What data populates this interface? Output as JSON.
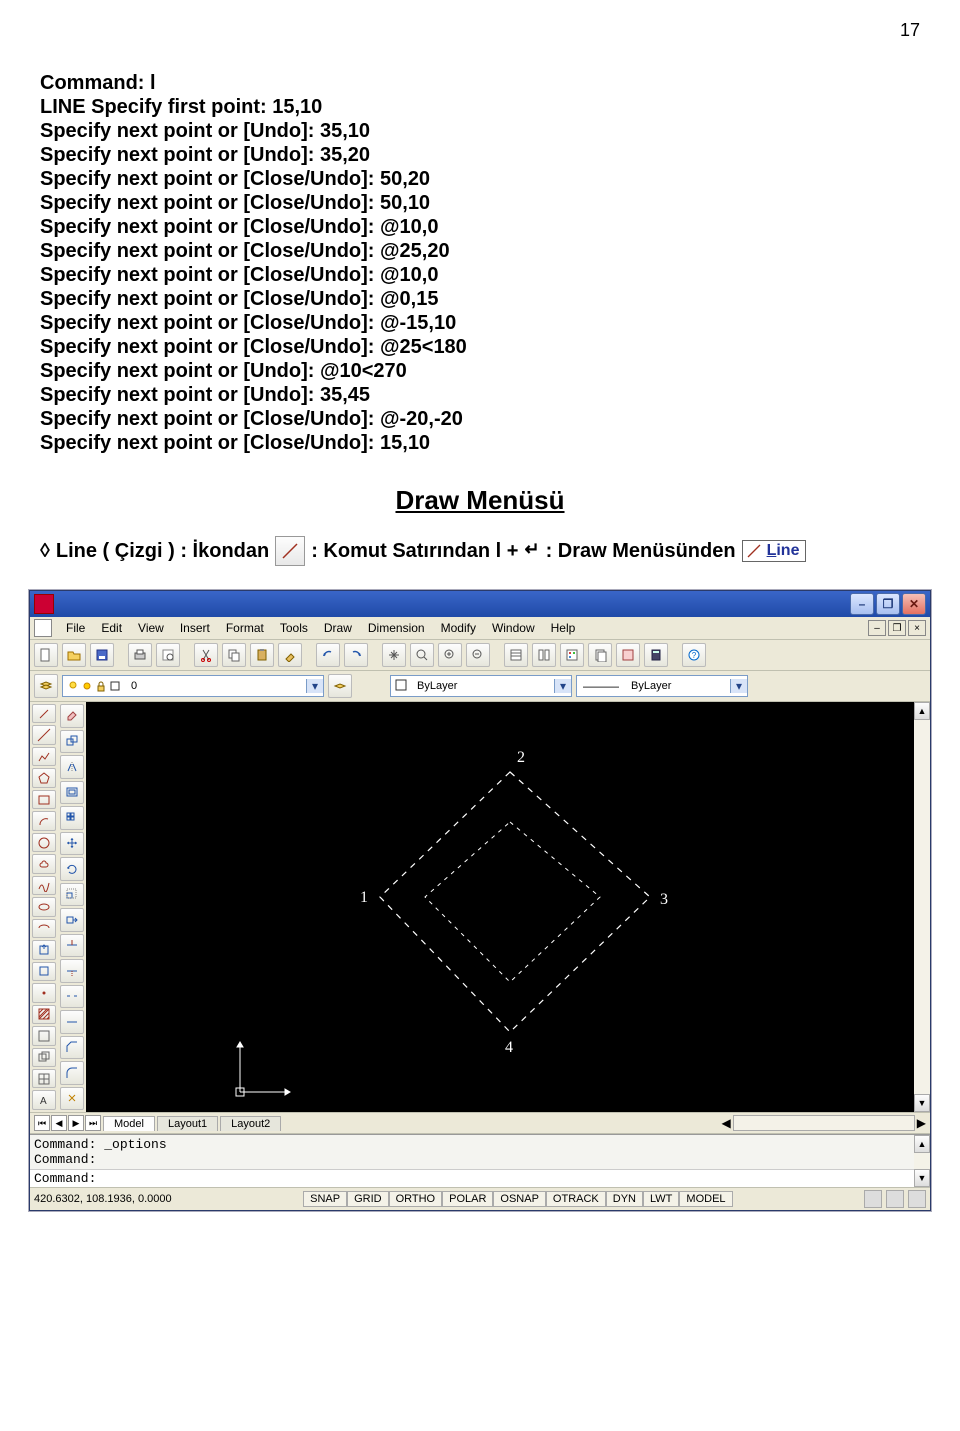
{
  "page_number": "17",
  "command_block": [
    "Command: l",
    "LINE Specify first point: 15,10",
    "Specify next point or [Undo]: 35,10",
    "Specify next point or [Undo]: 35,20",
    "Specify next point or [Close/Undo]: 50,20",
    "Specify next point or [Close/Undo]: 50,10",
    "Specify next point or [Close/Undo]: @10,0",
    "Specify next point or [Close/Undo]: @25,20",
    "Specify next point or [Close/Undo]: @10,0",
    "Specify next point or [Close/Undo]: @0,15",
    "Specify next point or [Close/Undo]: @-15,10",
    "Specify next point or [Close/Undo]: @25<180",
    "Specify next point or [Undo]: @10<270",
    "Specify next point or [Undo]: 35,45",
    "Specify next point or [Close/Undo]: @-20,-20",
    "Specify next point or [Close/Undo]: 15,10"
  ],
  "section_title": "Draw Menüsü",
  "line_desc": {
    "diamond": "◊",
    "label1": "Line ( Çizgi ) : İkondan",
    "label2": ": Komut Satırından  l +",
    "label3": ": Draw Menüsünden",
    "menu_item": "Line"
  },
  "app": {
    "title": "",
    "menus": [
      "File",
      "Edit",
      "View",
      "Insert",
      "Format",
      "Tools",
      "Draw",
      "Dimension",
      "Modify",
      "Window",
      "Help"
    ],
    "layer_combo": "0",
    "bylayer": "ByLayer",
    "linetype": "ByLayer",
    "tabs": [
      "Model",
      "Layout1",
      "Layout2"
    ],
    "cmd1": "Command: _options",
    "cmd2": "Command:",
    "cmd_prompt": "Command:",
    "coords": "420.6302, 108.1936, 0.0000",
    "toggles": [
      "SNAP",
      "GRID",
      "ORTHO",
      "POLAR",
      "OSNAP",
      "OTRACK",
      "DYN",
      "LWT",
      "MODEL"
    ],
    "canvas_labels": {
      "p1": "1",
      "p2": "2",
      "p3": "3",
      "p4": "4"
    }
  }
}
